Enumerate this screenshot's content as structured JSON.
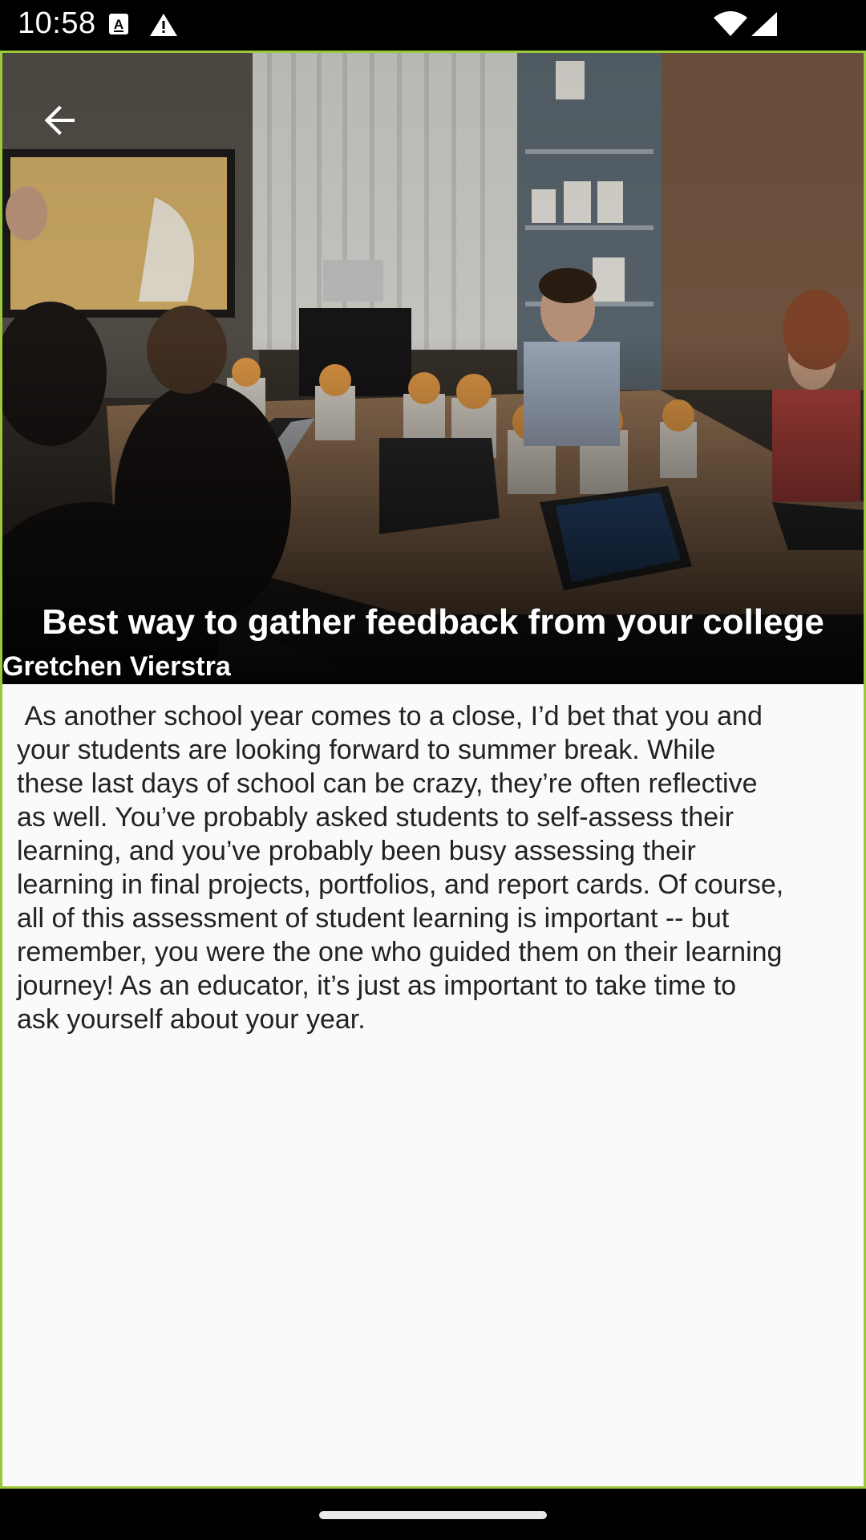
{
  "status_bar": {
    "time": "10:58",
    "icons": [
      "font-download-icon",
      "alert-icon",
      "wifi-icon",
      "signal-icon"
    ]
  },
  "header": {
    "back_icon": "arrow-left-icon",
    "image": "photo of people in a meeting room at a conference table with laptops and gift bags",
    "title": "Best way to gather feedback from your college"
  },
  "article": {
    "author": "Gretchen Vierstra",
    "body": " As another school year comes to a close, I’d bet that you and\nyour students are looking forward to summer break. While\nthese last days of school can be crazy, they’re often reflective\nas well. You’ve probably asked students to self-assess their\nlearning, and you’ve probably been busy assessing their\nlearning in final projects, portfolios, and report cards. Of course,\nall of this assessment of student learning is important -- but\nremember, you were the one who guided them on their learning\njourney! As an educator, it’s just as important to take time to\nask yourself about your year."
  },
  "colors": {
    "frame_border": "#9ac93a",
    "background": "#fafafa",
    "text": "#222222",
    "overlay_text": "#ffffff"
  }
}
